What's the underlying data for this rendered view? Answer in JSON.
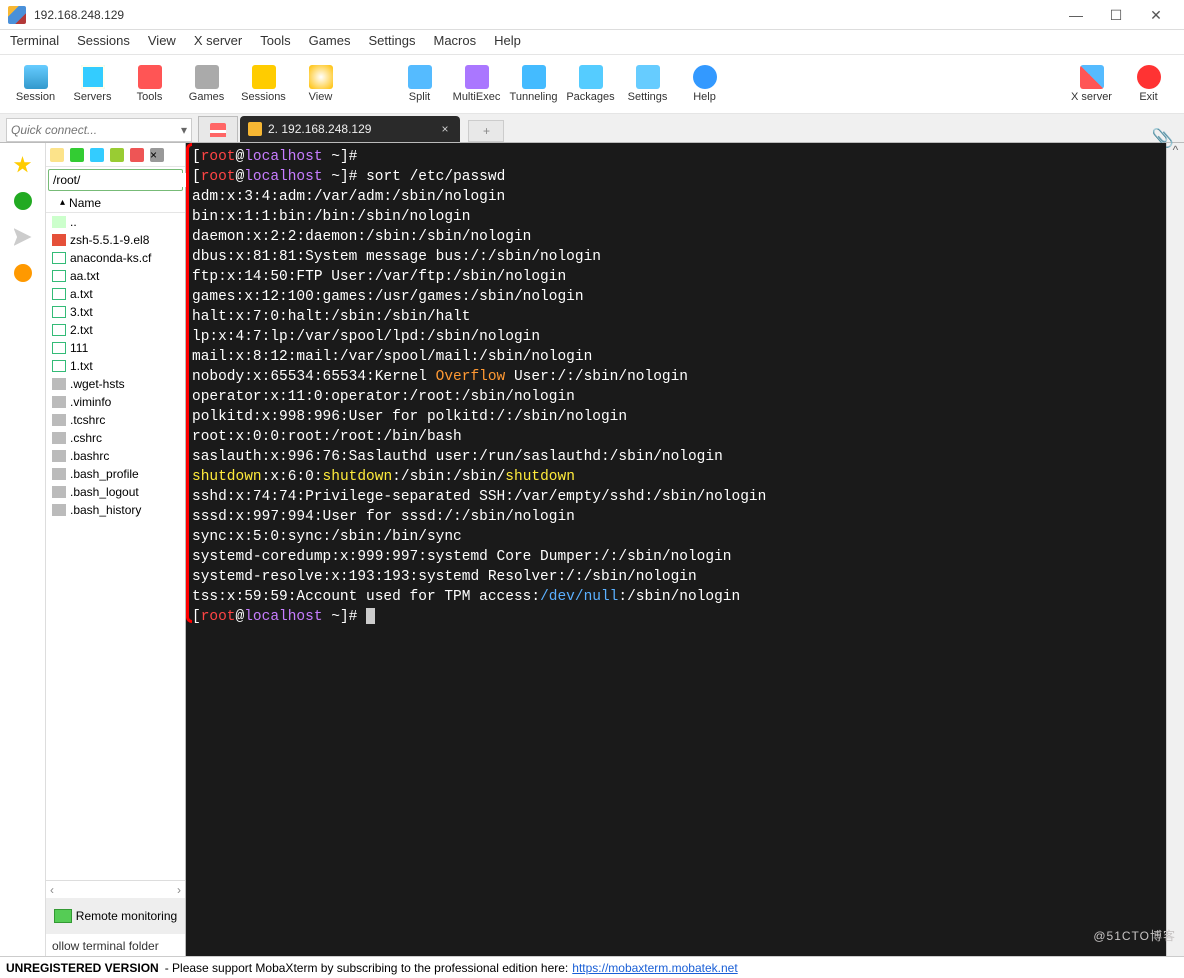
{
  "title": "192.168.248.129",
  "menu": [
    "Terminal",
    "Sessions",
    "View",
    "X server",
    "Tools",
    "Games",
    "Settings",
    "Macros",
    "Help"
  ],
  "toolbar": [
    "Session",
    "Servers",
    "Tools",
    "Games",
    "Sessions",
    "View",
    "Split",
    "MultiExec",
    "Tunneling",
    "Packages",
    "Settings",
    "Help"
  ],
  "toolbar_right": [
    "X server",
    "Exit"
  ],
  "quick_placeholder": "Quick connect...",
  "tab": {
    "label": "2. 192.168.248.129"
  },
  "fppath": "/root/",
  "fpheader": "Name",
  "files": [
    {
      "n": "..",
      "t": "up"
    },
    {
      "n": "zsh-5.5.1-9.el8",
      "t": "rpm"
    },
    {
      "n": "anaconda-ks.cf",
      "t": "txt"
    },
    {
      "n": "aa.txt",
      "t": "txt"
    },
    {
      "n": "a.txt",
      "t": "txt"
    },
    {
      "n": "3.txt",
      "t": "txt"
    },
    {
      "n": "2.txt",
      "t": "txt"
    },
    {
      "n": "111",
      "t": "txt"
    },
    {
      "n": "1.txt",
      "t": "txt"
    },
    {
      "n": ".wget-hsts",
      "t": "hidden"
    },
    {
      "n": ".viminfo",
      "t": "hidden"
    },
    {
      "n": ".tcshrc",
      "t": "hidden"
    },
    {
      "n": ".cshrc",
      "t": "hidden"
    },
    {
      "n": ".bashrc",
      "t": "hidden"
    },
    {
      "n": ".bash_profile",
      "t": "hidden"
    },
    {
      "n": ".bash_logout",
      "t": "hidden"
    },
    {
      "n": ".bash_history",
      "t": "hidden"
    }
  ],
  "remmon": "Remote monitoring",
  "belownote": "ollow terminal folder",
  "terminal": {
    "prompt_user": "root",
    "prompt_at": "@",
    "prompt_host": "localhost",
    "prompt_tail": " ~]#",
    "cmd": "sort /etc/passwd",
    "lines": [
      "adm:x:3:4:adm:/var/adm:/sbin/nologin",
      "bin:x:1:1:bin:/bin:/sbin/nologin",
      "daemon:x:2:2:daemon:/sbin:/sbin/nologin",
      "dbus:x:81:81:System message bus:/:/sbin/nologin",
      "ftp:x:14:50:FTP User:/var/ftp:/sbin/nologin",
      "games:x:12:100:games:/usr/games:/sbin/nologin",
      "halt:x:7:0:halt:/sbin:/sbin/halt",
      "lp:x:4:7:lp:/var/spool/lpd:/sbin/nologin",
      "mail:x:8:12:mail:/var/spool/mail:/sbin/nologin"
    ],
    "nobody_pre": "nobody:x:65534:65534:Kernel ",
    "nobody_hl": "Overflow",
    "nobody_post": " User:/:/sbin/nologin",
    "lines2": [
      "operator:x:11:0:operator:/root:/sbin/nologin",
      "polkitd:x:998:996:User for polkitd:/:/sbin/nologin",
      "root:x:0:0:root:/root:/bin/bash",
      "saslauth:x:996:76:Saslauthd user:/run/saslauthd:/sbin/nologin"
    ],
    "shutdown_pre": "shutdown",
    "shutdown_mid": ":x:6:0:",
    "shutdown_mid2": "shutdown",
    "shutdown_mid3": ":/sbin:/sbin/",
    "shutdown_end": "shutdown",
    "lines3": [
      "sshd:x:74:74:Privilege-separated SSH:/var/empty/sshd:/sbin/nologin",
      "sssd:x:997:994:User for sssd:/:/sbin/nologin",
      "sync:x:5:0:sync:/sbin:/bin/sync",
      "systemd-coredump:x:999:997:systemd Core Dumper:/:/sbin/nologin",
      "systemd-resolve:x:193:193:systemd Resolver:/:/sbin/nologin"
    ],
    "tss_pre": "tss:x:59:59:Account used for TPM access:",
    "tss_hl": "/dev/null",
    "tss_post": ":/sbin/nologin"
  },
  "footer": {
    "unreg": "UNREGISTERED VERSION",
    "msg": "  -  Please support MobaXterm by subscribing to the professional edition here:",
    "link": "https://mobaxterm.mobatek.net"
  },
  "watermark": "@51CTO博客"
}
